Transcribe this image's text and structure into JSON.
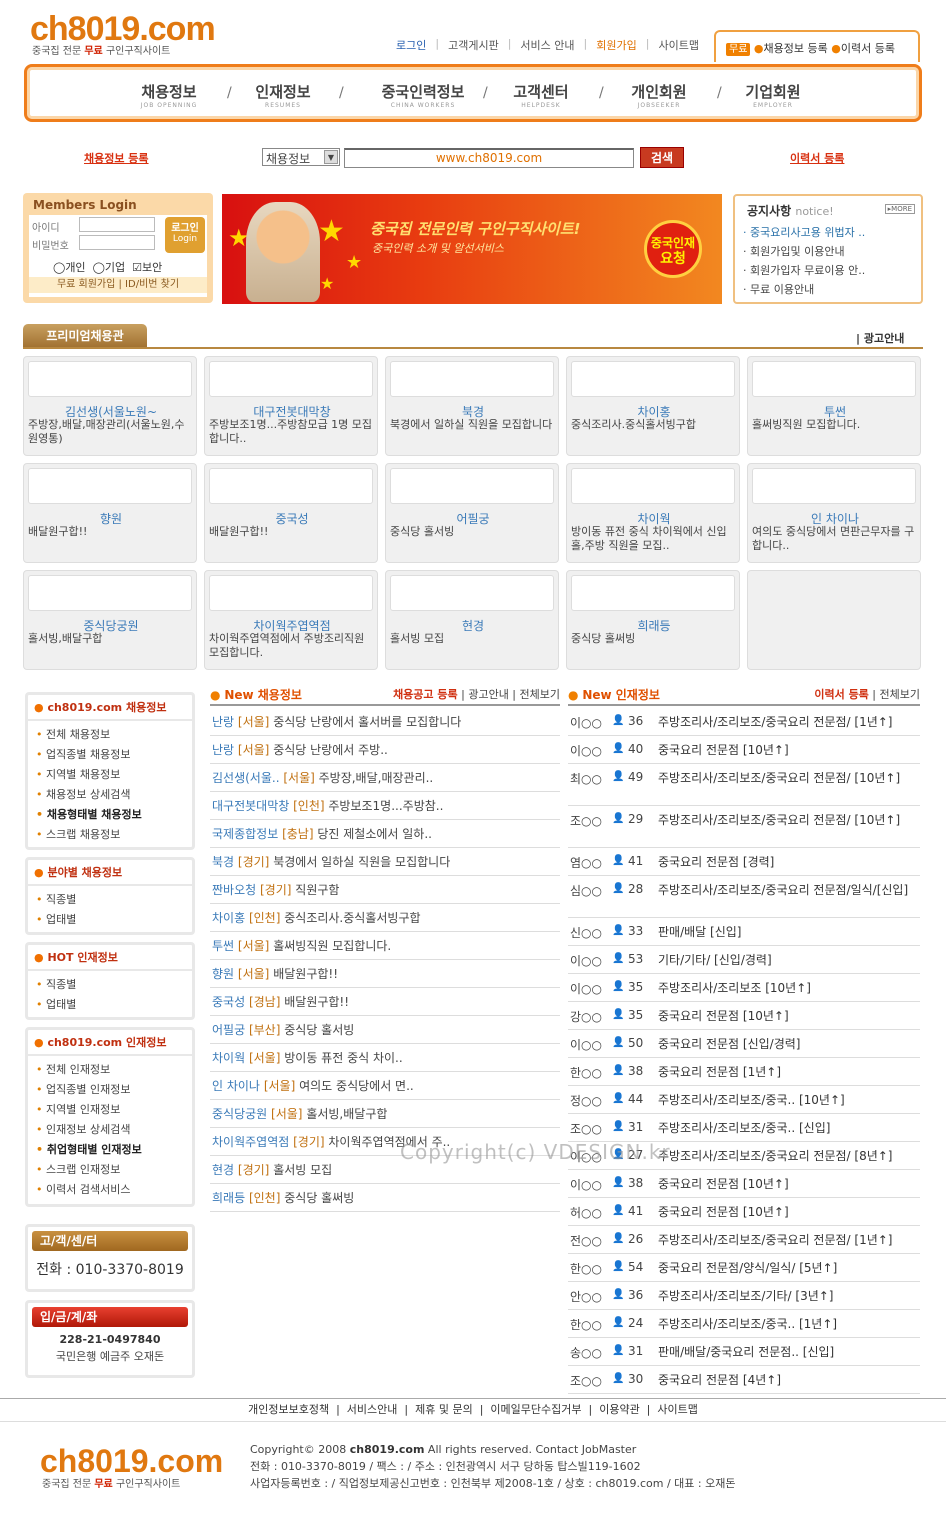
{
  "header": {
    "logo": "ch8019.com",
    "logo_sub_pre": "중국집 전문 ",
    "logo_sub_free": "무료",
    "logo_sub_post": " 구인구직사이트",
    "topnav": [
      "로그인",
      "고객게시판",
      "서비스 안내",
      "회원가입",
      "사이트맵"
    ],
    "topbox_free": "무료",
    "topbox_items": [
      "채용정보 등록",
      "이력서 등록"
    ]
  },
  "nav": [
    {
      "ko": "채용정보",
      "en": "JOB OPENNING"
    },
    {
      "ko": "인재정보",
      "en": "RESUMES"
    },
    {
      "ko": "중국인력정보",
      "en": "CHINA WORKERS"
    },
    {
      "ko": "고객센터",
      "en": "HELPDESK"
    },
    {
      "ko": "개인회원",
      "en": "JOBSEEKER"
    },
    {
      "ko": "기업회원",
      "en": "EMPLOYER"
    }
  ],
  "search": {
    "reg_job": "채용정보 등록",
    "reg_resume": "이력서 등록",
    "select": "채용정보",
    "value": "www.ch8019.com",
    "button": "검색"
  },
  "login": {
    "title": "Members Login",
    "id_label": "아이디",
    "pw_label": "비밀번호",
    "button_ko": "로그인",
    "button_en": "Login",
    "opt_personal": "개인",
    "opt_company": "기업",
    "opt_secure": "보안",
    "links": "무료 회원가입  |  ID/비번 찾기"
  },
  "banner": {
    "line1": "중국집 전문인력 구인구직사이트!",
    "line2": "중국인력 소개 및 알선서비스",
    "circle1": "중국인재",
    "circle2": "요청"
  },
  "notice": {
    "title": "공지사항",
    "title_en": "notice!",
    "more": "MORE",
    "items": [
      "중국요리사고용 위법자 ..",
      "회원가입및 이용안내",
      "회원가입자 무료이용 안..",
      "무료 이용안내"
    ]
  },
  "premium": {
    "tab": "프리미엄채용관",
    "ad_info": "광고안내",
    "cards": [
      {
        "name": "김선생(서울노원~",
        "desc": "주방장,배달,매장관리(서울노원,수원영통)",
        "img": "logo-boat"
      },
      {
        "name": "대구전봇대막창",
        "desc": "주방보조1명...주방참모급 1명 모집합니다..",
        "img": "LOGO"
      },
      {
        "name": "북경",
        "desc": "북경에서 일하실 직원을 모집합니다",
        "img": "banner"
      },
      {
        "name": "차이홍",
        "desc": "중식조리사.중식홀서빙구합",
        "img": "banner"
      },
      {
        "name": "투썬",
        "desc": "홀써빙직원 모집합니다.",
        "img": "banner"
      },
      {
        "name": "향원",
        "desc": "배달원구합!!",
        "img": "banner"
      },
      {
        "name": "중국성",
        "desc": "배달원구합!!",
        "img": "中國城"
      },
      {
        "name": "어필궁",
        "desc": "중식당 홀서빙",
        "img": "banner"
      },
      {
        "name": "차이웍",
        "desc": "방이동 퓨전 중식 차이웍에서 신입 홀,주방 직원을 모집..",
        "img": "차이웍"
      },
      {
        "name": "인 차이나",
        "desc": "여의도 중식당에서 면판근무자를 구합니다..",
        "img": "banner"
      },
      {
        "name": "중식당궁원",
        "desc": "홀서빙,배달구합",
        "img": "banner"
      },
      {
        "name": "차이웍주엽역점",
        "desc": "차이웍주엽역점에서 주방조리직원 모집합니다.",
        "img": "banner"
      },
      {
        "name": "현경",
        "desc": "홀서빙 모집",
        "img": "small-banner"
      },
      {
        "name": "희래등",
        "desc": "중식당 홀써빙",
        "img": "banner"
      },
      {
        "name": "",
        "desc": "",
        "img": "ch8019.com"
      }
    ]
  },
  "leftmenu": {
    "box1": {
      "title": "ch8019.com 채용정보",
      "items": [
        "전체 채용정보",
        "업직종별 채용정보",
        "지역별 채용정보",
        "채용정보 상세검색",
        "채용형태별 채용정보",
        "스크랩 채용정보"
      ]
    },
    "box2": {
      "title": "분야별 채용정보",
      "items": [
        "직종별",
        "업태별"
      ]
    },
    "box3": {
      "title": "HOT 인재정보",
      "items": [
        "직종별",
        "업태별"
      ]
    },
    "box4": {
      "title": "ch8019.com 인재정보",
      "items": [
        "전체 인재정보",
        "업직종별 인재정보",
        "지역별 인재정보",
        "인재정보 상세검색",
        "취업형태별 인재정보",
        "스크랩 인재정보",
        "이력서 검색서비스"
      ]
    },
    "cc_title": "고/객/센/터",
    "cc_phone": "전화 : 010-3370-8019",
    "acc_title": "입/금/계/좌",
    "acc_number": "228-21-0497840",
    "acc_bank": "국민은행 예금주 오재돈"
  },
  "jobs": {
    "title": "New 채용정보",
    "reg": "채용공고 등록",
    "ad": "광고안내",
    "all": "전체보기",
    "rows": [
      {
        "co": "난랑",
        "rg": "[서울]",
        "t": "중식당 난랑에서 홀서버를 모집합니다"
      },
      {
        "co": "난랑",
        "rg": "[서울]",
        "t": "중식당 난랑에서 주방.."
      },
      {
        "co": "김선생(서울..",
        "rg": "[서울]",
        "t": "주방장,배달,매장관리.."
      },
      {
        "co": "대구전봇대막창",
        "rg": "[인천]",
        "t": "주방보조1명...주방참.."
      },
      {
        "co": "국제종합정보",
        "rg": "[충남]",
        "t": "당진 제철소에서 일하.."
      },
      {
        "co": "북경",
        "rg": "[경기]",
        "t": "북경에서 일하실 직원을 모집합니다"
      },
      {
        "co": "짠바오청",
        "rg": "[경기]",
        "t": "직원구함"
      },
      {
        "co": "차이홍",
        "rg": "[인천]",
        "t": "중식조리사.중식홀서빙구합"
      },
      {
        "co": "투썬",
        "rg": "[서울]",
        "t": "홀써빙직원 모집합니다."
      },
      {
        "co": "향원",
        "rg": "[서울]",
        "t": "배달원구합!!"
      },
      {
        "co": "중국성",
        "rg": "[경남]",
        "t": "배달원구합!!"
      },
      {
        "co": "어필궁",
        "rg": "[부산]",
        "t": "중식당 홀서빙"
      },
      {
        "co": "차이웍",
        "rg": "[서울]",
        "t": "방이동 퓨전 중식 차이.."
      },
      {
        "co": "인 차이나",
        "rg": "[서울]",
        "t": "여의도 중식당에서 면.."
      },
      {
        "co": "중식당궁원",
        "rg": "[서울]",
        "t": "홀서빙,배달구합"
      },
      {
        "co": "차이웍주엽역점",
        "rg": "[경기]",
        "t": "차이웍주엽역점에서 주.."
      },
      {
        "co": "현경",
        "rg": "[경기]",
        "t": "홀서빙 모집"
      },
      {
        "co": "희래등",
        "rg": "[인천]",
        "t": "중식당 홀써빙"
      }
    ]
  },
  "talents": {
    "title": "New 인재정보",
    "reg": "이력서 등록",
    "all": "전체보기",
    "rows": [
      {
        "nm": "이○○",
        "g": "m",
        "ag": "36",
        "jb": "주방조리사/조리보조/중국요리 전문점/ [1년↑]"
      },
      {
        "nm": "이○○",
        "g": "m",
        "ag": "40",
        "jb": "중국요리 전문점 [10년↑]"
      },
      {
        "nm": "최○○",
        "g": "m",
        "ag": "49",
        "jb": "주방조리사/조리보조/중국요리 전문점/ [10년↑]"
      },
      {
        "nm": "조○○",
        "g": "m",
        "ag": "29",
        "jb": "주방조리사/조리보조/중국요리 전문점/ [10년↑]"
      },
      {
        "nm": "염○○",
        "g": "m",
        "ag": "41",
        "jb": "중국요리 전문점 [경력]"
      },
      {
        "nm": "심○○",
        "g": "m",
        "ag": "28",
        "jb": "주방조리사/조리보조/중국요리 전문점/일식/[신입]"
      },
      {
        "nm": "신○○",
        "g": "m",
        "ag": "33",
        "jb": "판매/배달 [신입]"
      },
      {
        "nm": "이○○",
        "g": "m",
        "ag": "53",
        "jb": "기타/기타/ [신입/경력]"
      },
      {
        "nm": "이○○",
        "g": "m",
        "ag": "35",
        "jb": "주방조리사/조리보조 [10년↑]"
      },
      {
        "nm": "강○○",
        "g": "m",
        "ag": "35",
        "jb": "중국요리 전문점 [10년↑]"
      },
      {
        "nm": "이○○",
        "g": "m",
        "ag": "50",
        "jb": "중국요리 전문점 [신입/경력]"
      },
      {
        "nm": "한○○",
        "g": "f",
        "ag": "38",
        "jb": "중국요리 전문점 [1년↑]"
      },
      {
        "nm": "정○○",
        "g": "m",
        "ag": "44",
        "jb": "주방조리사/조리보조/중국.. [10년↑]"
      },
      {
        "nm": "조○○",
        "g": "m",
        "ag": "31",
        "jb": "주방조리사/조리보조/중국.. [신입]"
      },
      {
        "nm": "이○○",
        "g": "m",
        "ag": "27",
        "jb": "주방조리사/조리보조/중국요리 전문점/ [8년↑]"
      },
      {
        "nm": "이○○",
        "g": "f",
        "ag": "38",
        "jb": "중국요리 전문점 [10년↑]"
      },
      {
        "nm": "허○○",
        "g": "m",
        "ag": "41",
        "jb": "중국요리 전문점 [10년↑]"
      },
      {
        "nm": "전○○",
        "g": "m",
        "ag": "26",
        "jb": "주방조리사/조리보조/중국요리 전문점/ [1년↑]"
      },
      {
        "nm": "한○○",
        "g": "f",
        "ag": "54",
        "jb": "중국요리 전문점/양식/일식/ [5년↑]"
      },
      {
        "nm": "안○○",
        "g": "m",
        "ag": "36",
        "jb": "주방조리사/조리보조/기타/ [3년↑]"
      },
      {
        "nm": "한○○",
        "g": "m",
        "ag": "24",
        "jb": "주방조리사/조리보조/중국.. [1년↑]"
      },
      {
        "nm": "송○○",
        "g": "m",
        "ag": "31",
        "jb": "판매/배달/중국요리 전문점.. [신입]"
      },
      {
        "nm": "조○○",
        "g": "m",
        "ag": "30",
        "jb": "중국요리 전문점 [4년↑]"
      }
    ]
  },
  "watermark": "Copyright(c) VDESIGN.kr",
  "footer": {
    "links": [
      "개인정보보호정책",
      "서비스안내",
      "제휴 및 문의",
      "이메일무단수집거부",
      "이용약관",
      "사이트맵"
    ],
    "logo": "ch8019.com",
    "copyright_pre": "Copyright© 2008 ",
    "copyright_site": "ch8019.com",
    "copyright_post": " All rights reserved. Contact JobMaster",
    "line2": "전화 : 010-3370-8019 / 팩스 : / 주소 : 인천광역시 서구 당하동 탑스빌119-1602",
    "line3": "사업자등록번호 : / 직업정보제공신고번호 : 인천북부 제2008-1호 / 상호 : ch8019.com / 대표 : 오재돈"
  },
  "colors": {
    "accent": "#ef7d1a",
    "link_blue": "#3a7ab8",
    "red": "#d03010"
  }
}
